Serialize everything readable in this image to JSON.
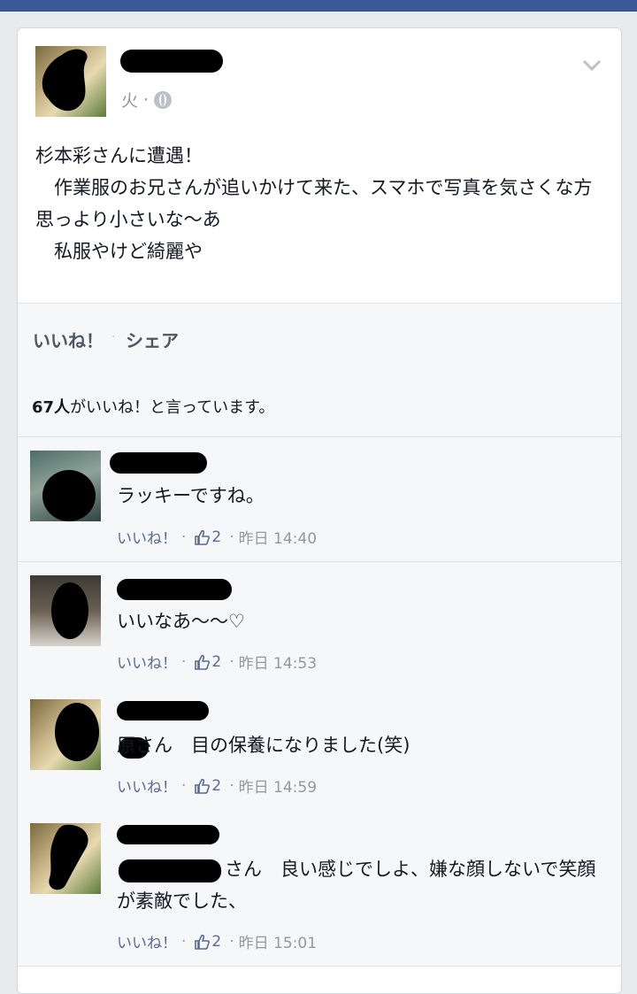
{
  "post": {
    "meta_day": "火",
    "meta_sep": "·",
    "text": "杉本彩さんに遭遇！\n　作業服のお兄さんが追いかけて来た、スマホで写真を気さくな方思っより小さいな〜あ\n　私服やけど綺麗や"
  },
  "actions": {
    "like": "いいね！",
    "dot": "·",
    "share": "シェア"
  },
  "likes_summary": {
    "count": "67人",
    "suffix": "がいいね！と言っています。"
  },
  "comments": [
    {
      "text": "ラッキーですね。",
      "like": "いいね！",
      "sep": "·",
      "count": "2",
      "time": "昨日 14:40"
    },
    {
      "text": "いいなあ〜〜♡",
      "like": "いいね！",
      "sep": "·",
      "count": "2",
      "time": "昨日 14:53"
    },
    {
      "text": "原さん　目の保養になりました(笑)",
      "like": "いいね！",
      "sep": "·",
      "count": "2",
      "time": "昨日 14:59"
    },
    {
      "text": "さん　良い感じでしよ、嫌な顔しないで笑顔が素敵でした、",
      "like": "いいね！",
      "sep": "·",
      "count": "2",
      "time": "昨日 15:01"
    }
  ],
  "colors": {
    "brand": "#3b5998",
    "link": "#576b95",
    "meta": "#9197a3"
  }
}
